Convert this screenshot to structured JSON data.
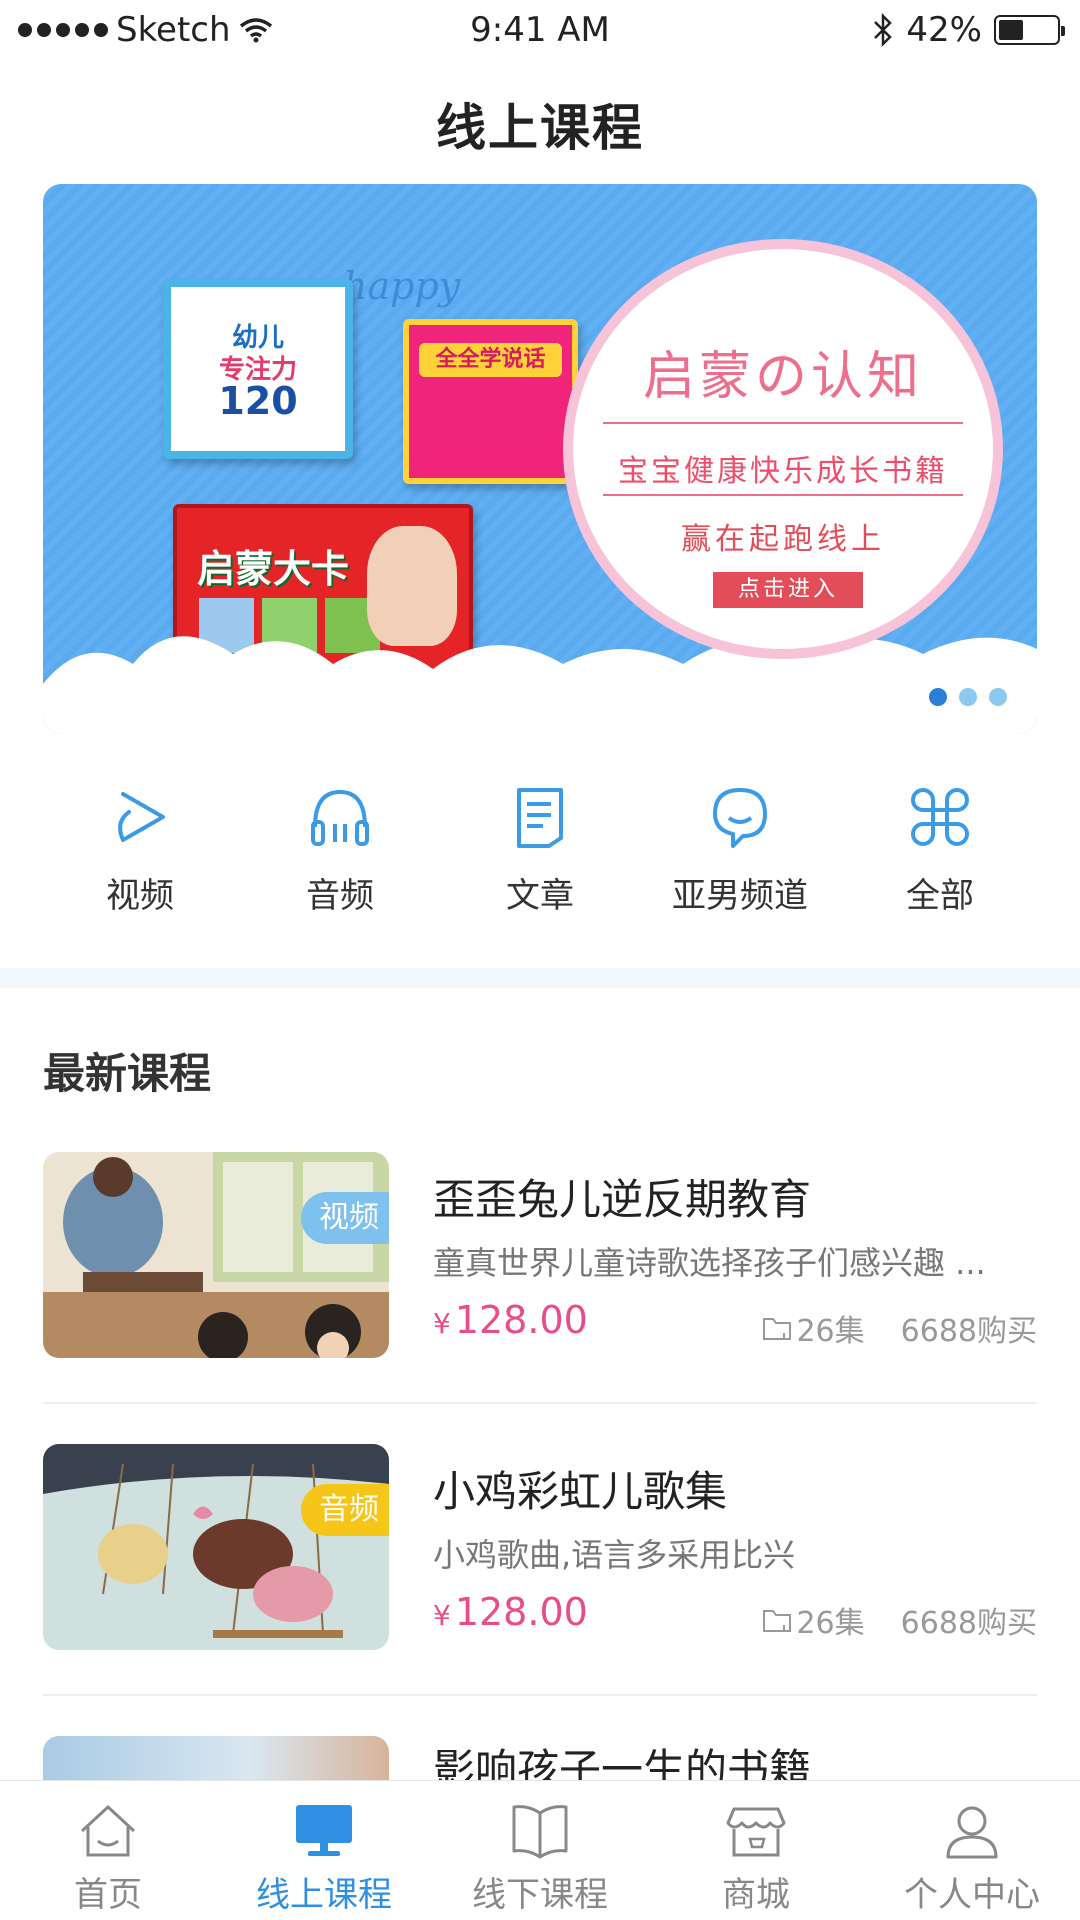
{
  "status_bar": {
    "carrier": "Sketch",
    "time": "9:41 AM",
    "battery": "42%",
    "battery_level": 0.42
  },
  "page_title": "线上课程",
  "banner": {
    "headline": "启蒙の认知",
    "subline": "宝宝健康快乐成长书籍",
    "tagline": "赢在起跑线上",
    "cta": "点击进入",
    "happy": "happy",
    "book1_lines": [
      "幼儿",
      "专注力",
      "120"
    ],
    "book2_title": "全全学说话",
    "box_title": "启蒙大卡",
    "slides_count": 3,
    "active_slide": 1
  },
  "quick_nav": [
    {
      "label": "视频",
      "icon": "play-icon"
    },
    {
      "label": "音频",
      "icon": "headphones-icon"
    },
    {
      "label": "文章",
      "icon": "document-icon"
    },
    {
      "label": "亚男频道",
      "icon": "chat-icon"
    },
    {
      "label": "全部",
      "icon": "grid-icon"
    }
  ],
  "section_title": "最新课程",
  "courses": [
    {
      "title": "歪歪兔儿逆反期教育",
      "desc": "童真世界儿童诗歌选择孩子们感兴趣 ...",
      "currency": "¥",
      "price": "128.00",
      "episodes": "26集",
      "purchases": "6688购买",
      "tag": "视频",
      "tag_color": "#7ec0ee"
    },
    {
      "title": "小鸡彩虹儿歌集",
      "desc": "小鸡歌曲,语言多采用比兴",
      "currency": "¥",
      "price": "128.00",
      "episodes": "26集",
      "purchases": "6688购买",
      "tag": "音频",
      "tag_color": "#f5c518"
    },
    {
      "title": "影响孩子一生的书籍"
    }
  ],
  "tab_bar": [
    {
      "label": "首页",
      "icon": "home-icon",
      "active": false
    },
    {
      "label": "线上课程",
      "icon": "monitor-icon",
      "active": true
    },
    {
      "label": "线下课程",
      "icon": "book-icon",
      "active": false
    },
    {
      "label": "商城",
      "icon": "shop-icon",
      "active": false
    },
    {
      "label": "个人中心",
      "icon": "person-icon",
      "active": false
    }
  ],
  "colors": {
    "accent": "#2f8fe0",
    "price": "#e84c8b",
    "icon": "#3c9be6"
  }
}
